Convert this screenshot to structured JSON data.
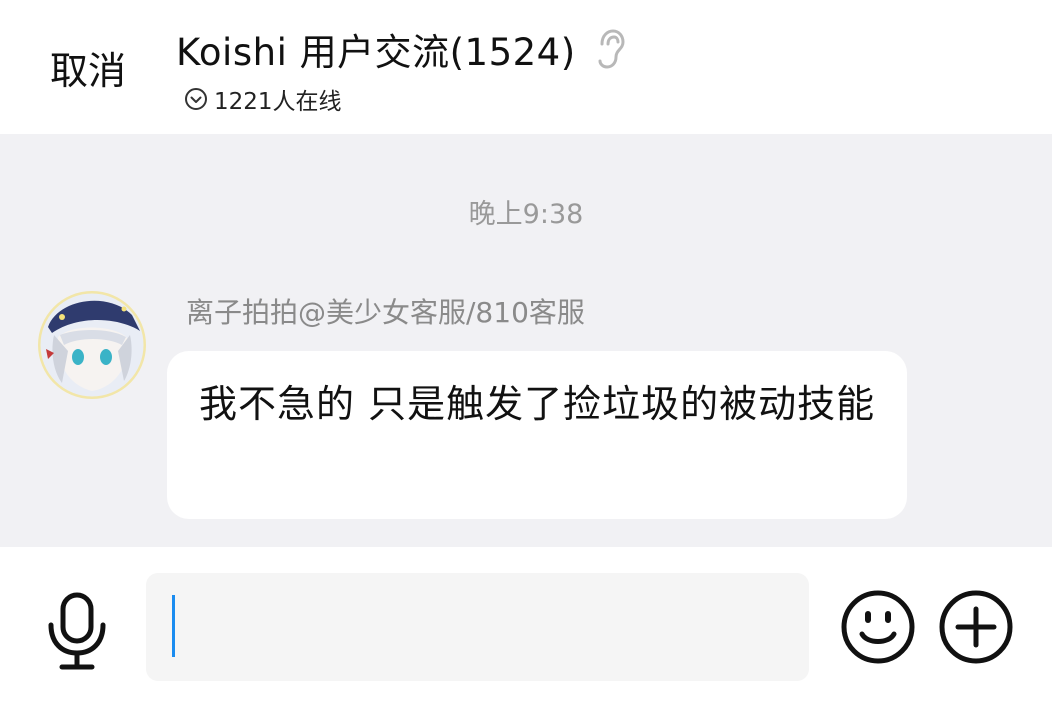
{
  "header": {
    "cancel_label": "取消",
    "title": "Koishi 用户交流(1524)",
    "online_text": "1221人在线"
  },
  "chat": {
    "timestamp": "晚上9:38",
    "messages": [
      {
        "sender": "离子拍拍@美少女客服/810客服",
        "text": "我不急的  只是触发了捡垃圾的被动技能"
      }
    ]
  },
  "input": {
    "value": ""
  },
  "icons": {
    "ear": "ear-icon",
    "online": "chevron-circle-icon",
    "mic": "microphone-icon",
    "emoji": "smiley-icon",
    "plus": "plus-circle-icon"
  },
  "colors": {
    "chat_background": "#f1f1f4",
    "caret": "#1a8cf0",
    "timestamp": "#999999",
    "sender": "#8a8a8a"
  }
}
